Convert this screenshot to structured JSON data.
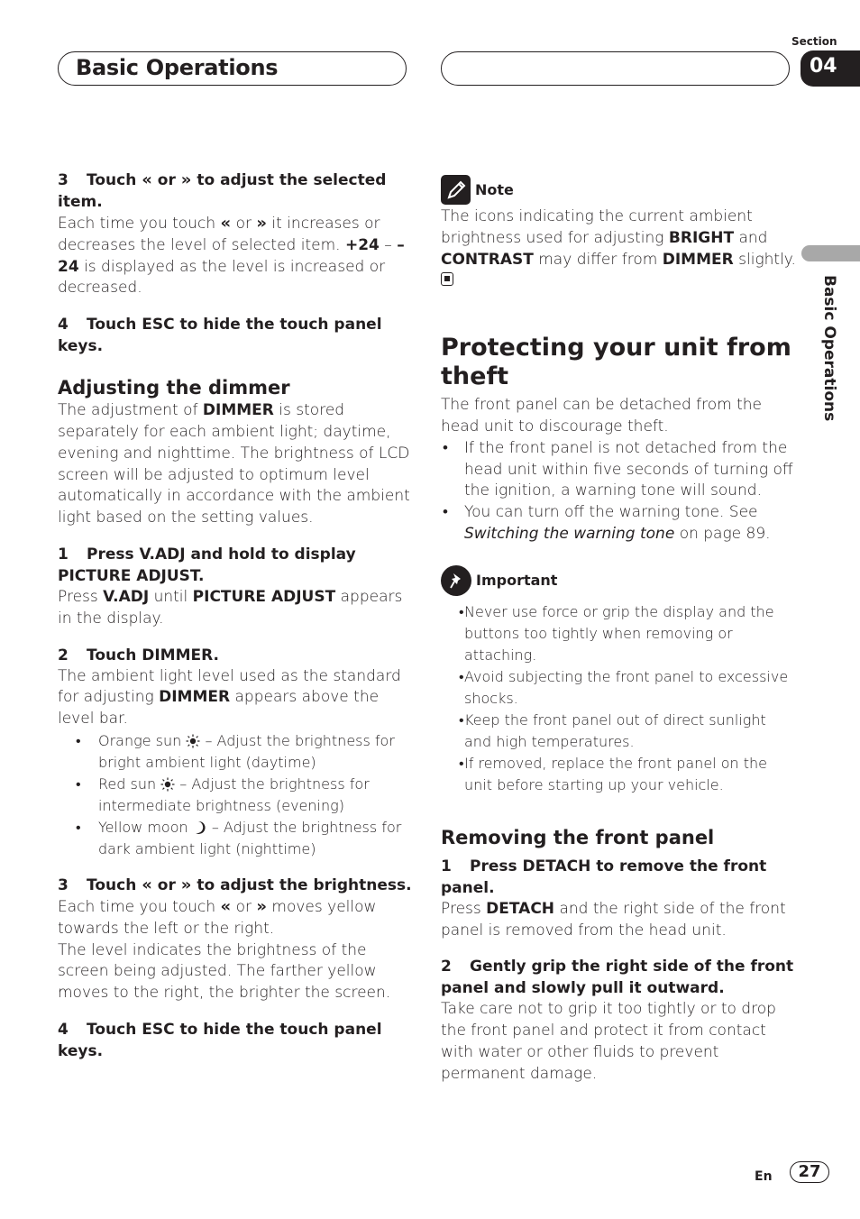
{
  "header": {
    "title": "Basic Operations",
    "section_label": "Section",
    "section_number": "04",
    "side_tab_text": "Basic Operations"
  },
  "left": {
    "step3a": {
      "num": "3",
      "text_pre": "Touch",
      "left_icon": "«",
      "or": "or",
      "right_icon": "»",
      "text_post": "to adjust the selected item."
    },
    "step3a_body": {
      "pre": "Each time you touch",
      "or": "or",
      "post": "it increases or decreases the level of selected item.",
      "val1": "+24",
      "dash": "–",
      "val2": "–24",
      "tail": "is displayed as the level is increased or decreased."
    },
    "step4a": {
      "num": "4",
      "text": "Touch ESC to hide the touch panel keys."
    },
    "dimmer_heading": "Adjusting the dimmer",
    "dimmer_body": {
      "pre": "The adjustment of",
      "bold": "DIMMER",
      "post": "is stored separately for each ambient light; daytime, evening and nighttime. The brightness of LCD screen will be adjusted to optimum level automatically in accordance with the ambient light based on the setting values."
    },
    "step1": {
      "num": "1",
      "text": "Press V.ADJ and hold to display PICTURE ADJUST."
    },
    "step1_body": {
      "pre": "Press",
      "b1": "V.ADJ",
      "mid": "until",
      "b2": "PICTURE ADJUST",
      "post": "appears in the display."
    },
    "step2": {
      "num": "2",
      "text": "Touch DIMMER."
    },
    "step2_body": {
      "pre": "The ambient light level used as the standard for adjusting",
      "bold": "DIMMER",
      "post": "appears above the level bar."
    },
    "bullets": [
      {
        "label": "Orange sun",
        "icon": "sun-icon",
        "text": "– Adjust the brightness for bright ambient light (daytime)"
      },
      {
        "label": "Red sun",
        "icon": "sun-icon",
        "text": "– Adjust the brightness for intermediate brightness (evening)"
      },
      {
        "label": "Yellow moon",
        "icon": "moon-icon",
        "text": "– Adjust the brightness for dark ambient light (nighttime)"
      }
    ],
    "step3b": {
      "num": "3",
      "text_pre": "Touch",
      "left_icon": "«",
      "or": "or",
      "right_icon": "»",
      "text_post": "to adjust the brightness."
    },
    "step3b_body": {
      "pre": "Each time you touch",
      "or": "or",
      "post": "moves yellow towards the left or the right."
    },
    "step3b_body2": "The level indicates the brightness of the screen being adjusted. The farther yellow moves to the right, the brighter the screen.",
    "step4b": {
      "num": "4",
      "text": "Touch ESC to hide the touch panel keys."
    }
  },
  "right": {
    "note_label": "Note",
    "note_body": {
      "pre": "The icons indicating the current ambient brightness used for adjusting",
      "b1": "BRIGHT",
      "mid": "and",
      "b2": "CONTRAST",
      "mid2": "may differ from",
      "b3": "DIMMER",
      "post": "slightly."
    },
    "theft_heading": "Protecting your unit from theft",
    "theft_body": "The front panel can be detached from the head unit to discourage theft.",
    "theft_bullets": [
      "If the front panel is not detached from the head unit within five seconds of turning off the ignition, a warning tone will sound.",
      {
        "pre": "You can turn off the warning tone. See",
        "italic": "Switching the warning tone",
        "post": "on page 89."
      }
    ],
    "important_label": "Important",
    "important_bullets": [
      "Never use force or grip the display and the buttons too tightly when removing or attaching.",
      "Avoid subjecting the front panel to excessive shocks.",
      "Keep the front panel out of direct sunlight and high temperatures.",
      "If removed, replace the front panel on the unit before starting up your vehicle."
    ],
    "removing_heading": "Removing the front panel",
    "rstep1": {
      "num": "1",
      "text": "Press DETACH to remove the front panel."
    },
    "rstep1_body": {
      "pre": "Press",
      "bold": "DETACH",
      "post": "and the right side of the front panel is removed from the head unit."
    },
    "rstep2": {
      "num": "2",
      "text": "Gently grip the right side of the front panel and slowly pull it outward."
    },
    "rstep2_body": "Take care not to grip it too tightly or to drop the front panel and protect it from contact with water or other fluids to prevent permanent damage."
  },
  "footer": {
    "lang": "En",
    "page": "27"
  }
}
